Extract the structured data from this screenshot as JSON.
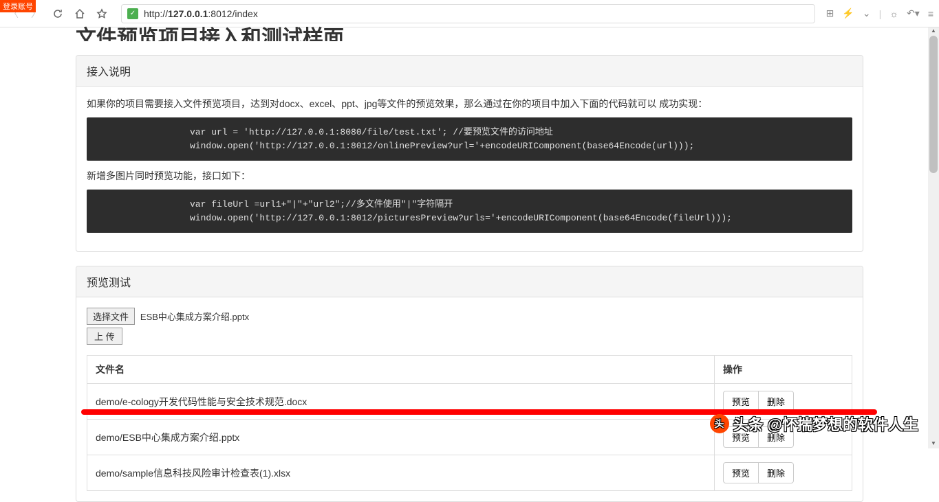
{
  "browser": {
    "url_prefix": "http://",
    "url_host": "127.0.0.1",
    "url_port": ":8012",
    "url_path": "/index",
    "login_tag": "登录账号"
  },
  "page": {
    "title": "文件预览项目接入和测试样面"
  },
  "panel1": {
    "header": "接入说明",
    "intro": "如果你的项目需要接入文件预览项目，达到对docx、excel、ppt、jpg等文件的预览效果，那么通过在你的项目中加入下面的代码就可以 成功实现：",
    "code1": "var url = 'http://127.0.0.1:8080/file/test.txt'; //要预览文件的访问地址\nwindow.open('http://127.0.0.1:8012/onlinePreview?url='+encodeURIComponent(base64Encode(url)));",
    "intro2": "新增多图片同时预览功能，接口如下：",
    "code2": "var fileUrl =url1+\"|\"+\"url2\";//多文件使用\"|\"字符隔开\nwindow.open('http://127.0.0.1:8012/picturesPreview?urls='+encodeURIComponent(base64Encode(fileUrl)));"
  },
  "panel2": {
    "header": "预览测试",
    "choose_file": "选择文件",
    "selected_file": "ESB中心集成方案介绍.pptx",
    "upload": "上 传",
    "col_filename": "文件名",
    "col_action": "操作",
    "preview_btn": "预览",
    "delete_btn": "删除",
    "rows": [
      {
        "name": "demo/e-cology开发代码性能与安全技术规范.docx"
      },
      {
        "name": "demo/ESB中心集成方案介绍.pptx"
      },
      {
        "name": "demo/sample信息科技风险审计检查表(1).xlsx"
      }
    ]
  },
  "watermark": {
    "prefix": "头条",
    "handle": "@怀揣梦想的软件人生"
  }
}
